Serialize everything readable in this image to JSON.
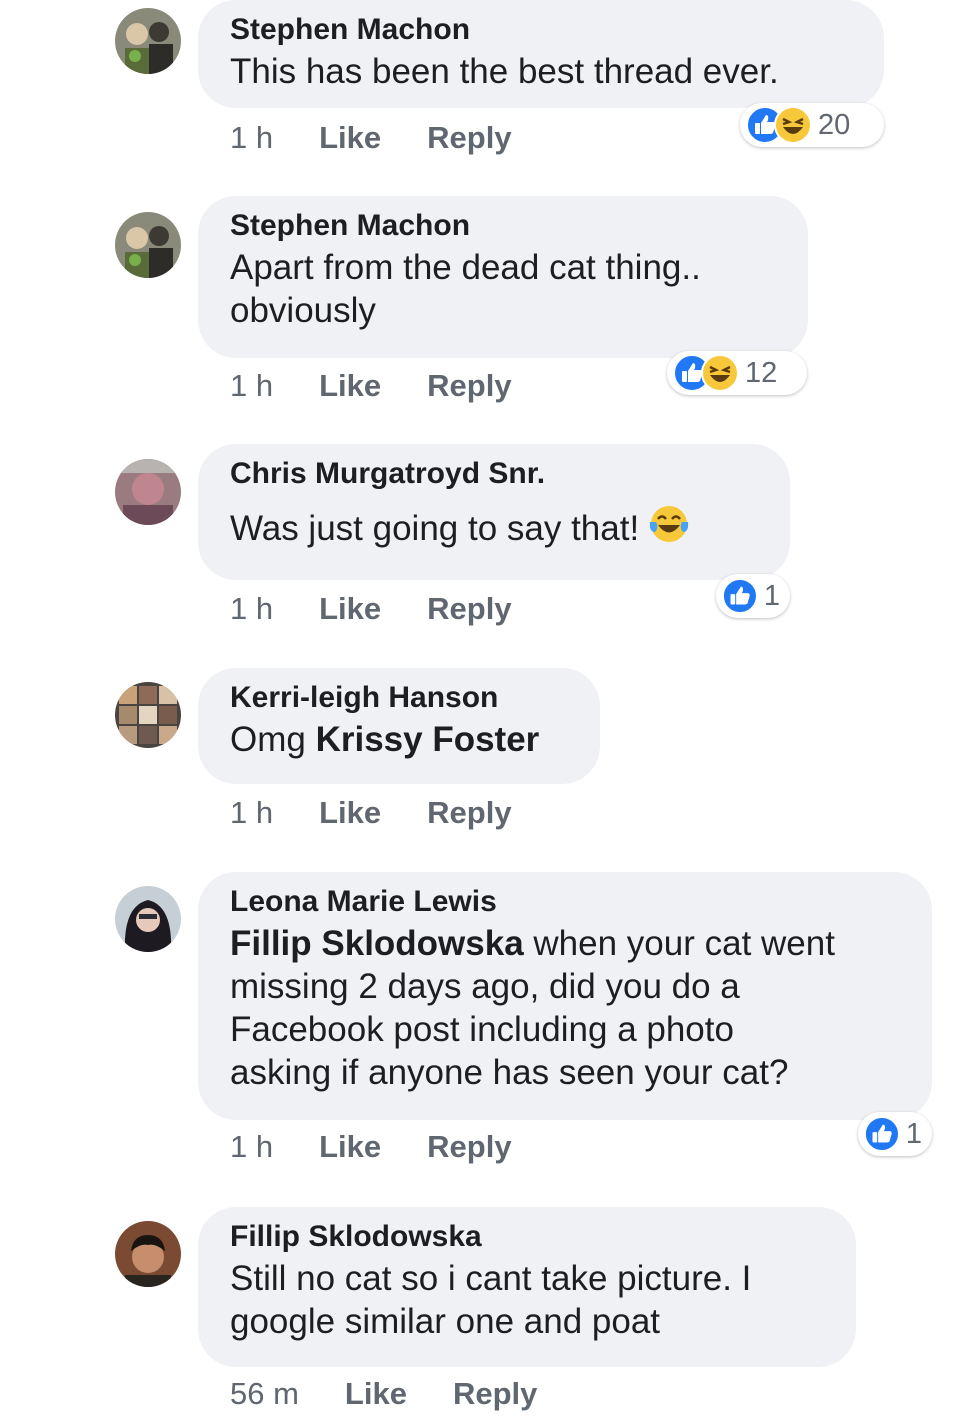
{
  "comments": [
    {
      "author": "Stephen Machon",
      "text": "This has been the best thread ever.",
      "time": "1 h",
      "like": "Like",
      "reply": "Reply",
      "reactions": [
        "like-icon",
        "haha-icon"
      ],
      "reaction_count": "20"
    },
    {
      "author": "Stephen Machon",
      "text_line1": "Apart from the dead cat thing..",
      "text_line2": "obviously",
      "time": "1 h",
      "like": "Like",
      "reply": "Reply",
      "reactions": [
        "like-icon",
        "haha-icon"
      ],
      "reaction_count": "12"
    },
    {
      "author": "Chris Murgatroyd Snr.",
      "text": "Was just going to say that!",
      "inline_emoji": "tears-of-joy-emoji",
      "time": "1 h",
      "like": "Like",
      "reply": "Reply",
      "reactions": [
        "like-icon"
      ],
      "reaction_count": "1"
    },
    {
      "author": "Kerri-leigh Hanson",
      "text_prefix": "Omg",
      "mention": "Krissy Foster",
      "time": "1 h",
      "like": "Like",
      "reply": "Reply"
    },
    {
      "author": "Leona Marie Lewis",
      "mention": "Fillip Sklodowska",
      "text_line1": "when your cat went",
      "text_line2": "missing 2 days ago, did you do a",
      "text_line3": "Facebook post including a photo",
      "text_line4": "asking if anyone has seen your cat?",
      "time": "1 h",
      "like": "Like",
      "reply": "Reply",
      "reactions": [
        "like-icon"
      ],
      "reaction_count": "1"
    },
    {
      "author": "Fillip Sklodowska",
      "text_line1": "Still no cat so i cant take picture. I",
      "text_line2": "google similar one and poat",
      "time": "56 m",
      "like": "Like",
      "reply": "Reply"
    }
  ],
  "colors": {
    "bubble": "#f0f1f4",
    "like_blue": "#2078f4",
    "haha_yellow": "#f7c83a",
    "meta_gray": "#606770"
  }
}
